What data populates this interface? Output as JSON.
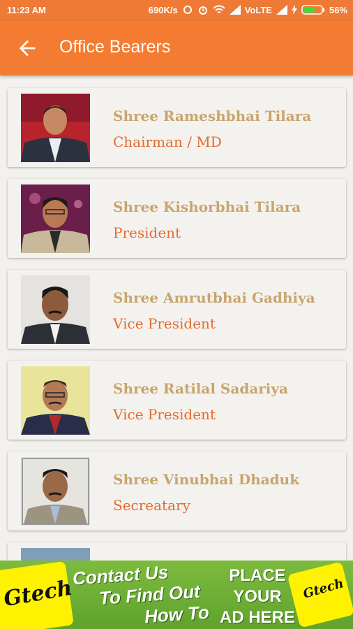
{
  "status": {
    "time": "11:23 AM",
    "speed": "690K/s",
    "network": "VoLTE",
    "battery": "56%"
  },
  "appbar": {
    "title": "Office Bearers"
  },
  "members": [
    {
      "name": "Shree Rameshbhai Tilara",
      "role": "Chairman / MD"
    },
    {
      "name": "Shree Kishorbhai Tilara",
      "role": "President"
    },
    {
      "name": "Shree Amrutbhai Gadhiya",
      "role": "Vice President"
    },
    {
      "name": "Shree Ratilal Sadariya",
      "role": "Vice President"
    },
    {
      "name": "Shree Vinubhai Dhaduk",
      "role": "Secreatary"
    }
  ],
  "ad": {
    "brand": "Gtech",
    "line1": "Contact Us",
    "line2": "To Find Out",
    "line3": "How To",
    "place1": "PLACE",
    "place2": "YOUR",
    "place3": "AD HERE"
  },
  "colors": {
    "appbar": "#f47c32",
    "name": "#c8a56e",
    "role": "#e36b2c",
    "ad": "#6aad34"
  }
}
